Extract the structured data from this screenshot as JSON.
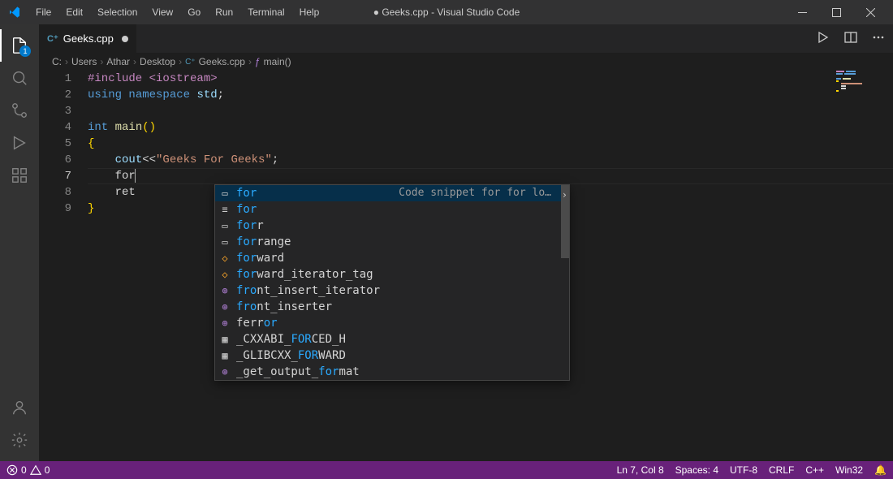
{
  "title_prefix": "●",
  "title_file": "Geeks.cpp",
  "title_suffix": "- Visual Studio Code",
  "menus": [
    "File",
    "Edit",
    "Selection",
    "View",
    "Go",
    "Run",
    "Terminal",
    "Help"
  ],
  "activity_badge": "1",
  "tab": {
    "icon": "C⁺",
    "label": "Geeks.cpp",
    "dirty": true
  },
  "breadcrumbs": [
    "C:",
    "Users",
    "Athar",
    "Desktop",
    "Geeks.cpp",
    "main()"
  ],
  "bc_cpp_icon": "C⁺",
  "bc_fn_icon": "ƒ",
  "line_numbers": [
    "1",
    "2",
    "3",
    "4",
    "5",
    "6",
    "7",
    "8",
    "9"
  ],
  "code": {
    "l1": {
      "pre": "#include",
      "angle": " <iostream>"
    },
    "l2": {
      "u": "using",
      "ns": "namespace",
      "std": "std",
      "semi": ";"
    },
    "l3": "",
    "l4": {
      "int": "int",
      "main": "main",
      "paren": "()"
    },
    "l5": "{",
    "l6": {
      "indent": "    ",
      "cout": "cout",
      "op": "<<",
      "str": "\"Geeks For Geeks\"",
      "semi": ";"
    },
    "l7": {
      "indent": "    ",
      "for": "for"
    },
    "l8": {
      "indent": "    ",
      "ret": "ret"
    },
    "l9": "}"
  },
  "autocomplete": {
    "doc": "Code snippet for for lo…",
    "items": [
      {
        "icon": "snippet",
        "pre": "",
        "match": "for",
        "post": ""
      },
      {
        "icon": "keyword",
        "pre": "",
        "match": "for",
        "post": ""
      },
      {
        "icon": "snippet",
        "pre": "",
        "match": "for",
        "post": "r"
      },
      {
        "icon": "snippet",
        "pre": "",
        "match": "for",
        "post": "range"
      },
      {
        "icon": "class",
        "pre": "",
        "match": "for",
        "post": "ward"
      },
      {
        "icon": "class",
        "pre": "",
        "match": "for",
        "post": "ward_iterator_tag"
      },
      {
        "icon": "func",
        "pre": "",
        "match": "fro",
        "post": "nt_insert_iterator"
      },
      {
        "icon": "func",
        "pre": "",
        "match": "fro",
        "post": "nt_inserter"
      },
      {
        "icon": "func",
        "pre": "f",
        "match": "",
        "post": "err",
        "match2": "or"
      },
      {
        "icon": "const",
        "pre": "_CXXABI_",
        "match": "FOR",
        "post": "CED_H"
      },
      {
        "icon": "const",
        "pre": "_GLIBCXX_",
        "match": "FOR",
        "post": "WARD"
      },
      {
        "icon": "func",
        "pre": "_get_output_",
        "match": "for",
        "post": "mat"
      }
    ]
  },
  "statusbar": {
    "errors": "0",
    "warnings": "0",
    "lncol": "Ln 7, Col 8",
    "spaces": "Spaces: 4",
    "encoding": "UTF-8",
    "eol": "CRLF",
    "lang": "C++",
    "target": "Win32",
    "bell": "🔔"
  }
}
